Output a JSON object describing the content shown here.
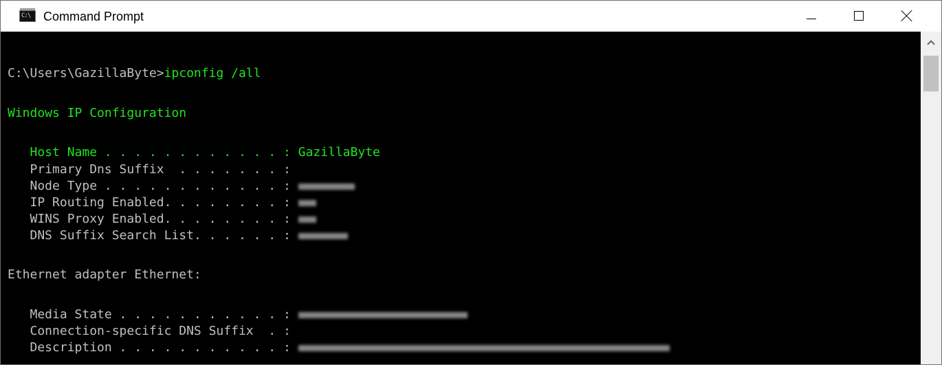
{
  "window": {
    "title": "Command Prompt",
    "icon_label": "C:\\"
  },
  "console": {
    "prompt": "C:\\Users\\GazillaByte>",
    "command": "ipconfig /all",
    "header": "Windows IP Configuration",
    "host_name_label": "   Host Name . . . . . . . . . . . . : ",
    "host_name_value": "GazillaByte",
    "primary_dns_label": "   Primary Dns Suffix  . . . . . . . :",
    "node_type_label": "   Node Type . . . . . . . . . . . . : ",
    "ip_routing_label": "   IP Routing Enabled. . . . . . . . : ",
    "wins_proxy_label": "   WINS Proxy Enabled. . . . . . . . : ",
    "dns_search_label": "   DNS Suffix Search List. . . . . . : ",
    "ethernet_header": "Ethernet adapter Ethernet:",
    "media_state_label": "   Media State . . . . . . . . . . . : ",
    "conn_dns_label": "   Connection-specific DNS Suffix  . :",
    "description_label": "   Description . . . . . . . . . . . : "
  },
  "colors": {
    "background": "#000000",
    "text": "#c0c0c0",
    "highlight": "#20e320"
  },
  "icons": {
    "app": "cmd-console-icon",
    "minimize": "minimize-icon",
    "maximize": "maximize-icon",
    "close": "close-icon",
    "scroll_up": "chevron-up-icon"
  }
}
